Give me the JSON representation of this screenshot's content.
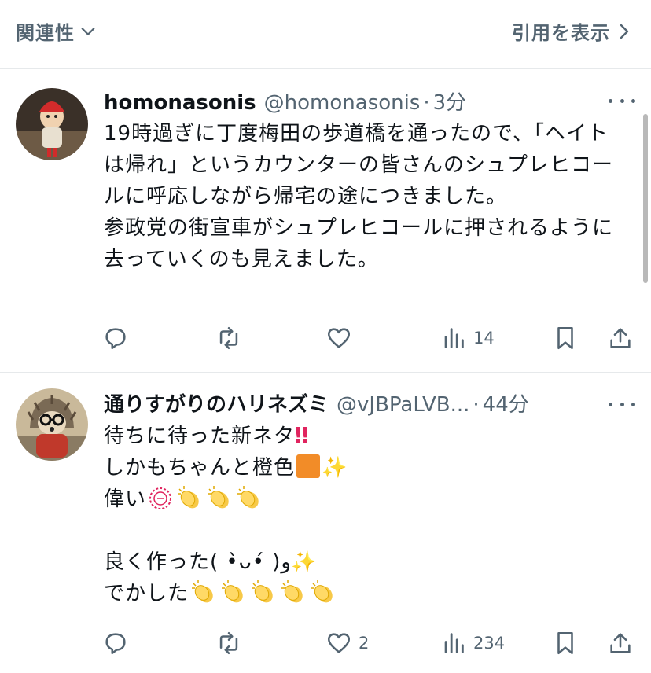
{
  "header": {
    "sort_label": "関連性",
    "quotes_label": "引用を表示"
  },
  "tweets": [
    {
      "display_name": "homonasonis",
      "handle": "@homonasonis",
      "separator": "·",
      "time": "3分",
      "text": "19時過ぎに丁度梅田の歩道橋を通ったので、「ヘイトは帰れ」というカウンターの皆さんのシュプレヒコールに呼応しながら帰宅の途につきました。\n参政党の街宣車がシュプレヒコールに押されるように去っていくのも見えました。",
      "actions": {
        "replies": "",
        "reposts": "",
        "likes": "",
        "views": "14"
      }
    },
    {
      "display_name": "通りすがりのハリネズミ",
      "handle": "@vJBPaLVB...",
      "separator": "·",
      "time": "44分",
      "lines": [
        {
          "text": "待ちに待った新ネタ",
          "emoji": [
            "double-exclamation"
          ]
        },
        {
          "text": "しかもちゃんと橙色",
          "emoji": [
            "orange-square",
            "sparkles"
          ]
        },
        {
          "text": "偉い",
          "emoji": [
            "excellent-stamp",
            "clapping-hands",
            "clapping-hands",
            "clapping-hands"
          ]
        },
        {
          "text": "",
          "emoji": []
        },
        {
          "text": "良く作った( •̀ᴗ•́ )و",
          "emoji": [
            "sparkles"
          ]
        },
        {
          "text": "でかした",
          "emoji": [
            "clapping-hands",
            "clapping-hands",
            "clapping-hands",
            "clapping-hands",
            "clapping-hands"
          ]
        }
      ],
      "actions": {
        "replies": "",
        "reposts": "",
        "likes": "2",
        "views": "234"
      }
    }
  ],
  "icons": {
    "sort": "chevron-down-icon",
    "quotes": "chevron-right-icon",
    "more": "more-dots-icon",
    "reply": "reply-icon",
    "repost": "repost-icon",
    "like": "heart-icon",
    "views": "views-icon",
    "bookmark": "bookmark-icon",
    "share": "share-icon"
  },
  "colors": {
    "text_primary": "#0f1419",
    "text_secondary": "#536471",
    "divider": "#e6e9eb",
    "orange_square": "#f28c28"
  }
}
